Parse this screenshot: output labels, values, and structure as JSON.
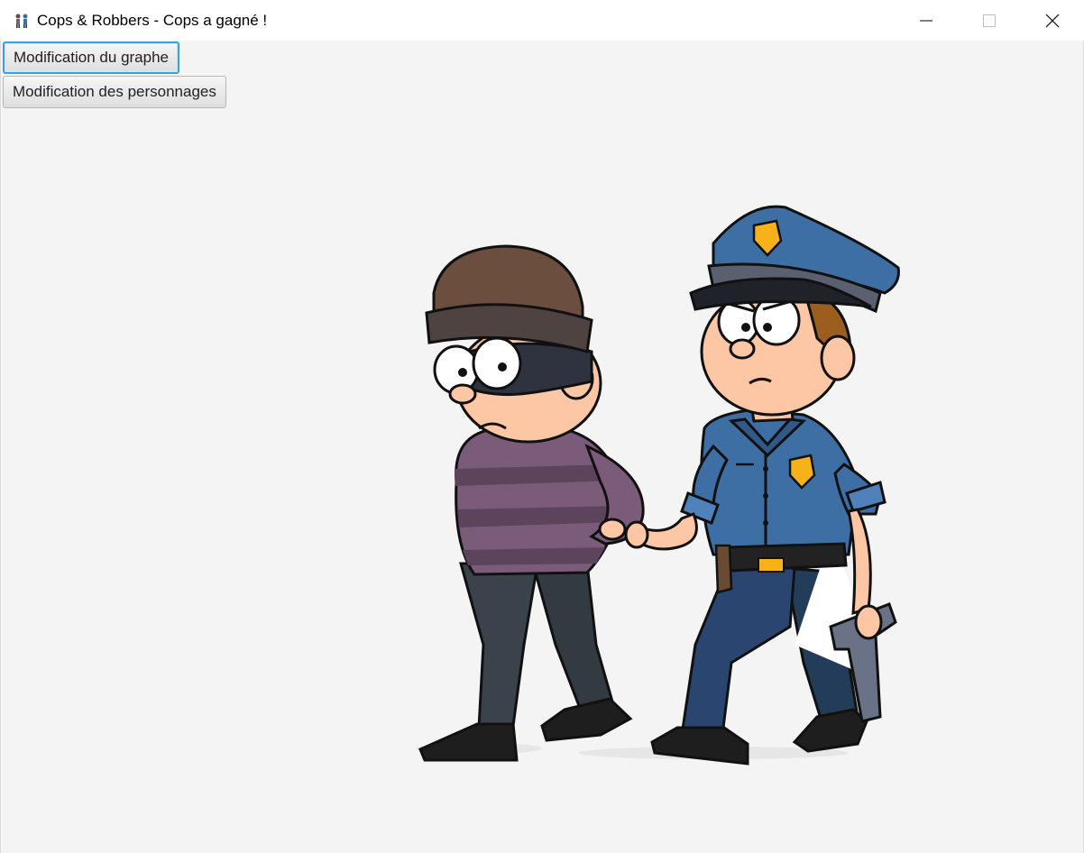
{
  "window": {
    "title": "Cops & Robbers - Cops a gagné !",
    "app_icon": "people-icon",
    "controls": [
      "minimize-icon",
      "maximize-icon",
      "close-icon"
    ]
  },
  "toolbar": {
    "graph_button_label": "Modification du graphe",
    "characters_button_label": "Modification des personnages"
  },
  "illustration": {
    "description_icon": "cop-arresting-robber-illustration"
  },
  "colors": {
    "background": "#f4f4f4",
    "focus_border": "#3aa2d8",
    "cop_uniform": "#3d6fa5",
    "robber_sweater": "#7a5c7a"
  }
}
